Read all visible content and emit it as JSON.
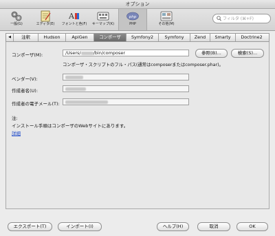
{
  "window": {
    "title": "オプション"
  },
  "toolbar": {
    "items": [
      {
        "label": "一般(G)",
        "icon": "general-settings-icon"
      },
      {
        "label": "エディタ(E)",
        "icon": "editor-icon"
      },
      {
        "label": "フォントと色(F)",
        "icon": "fonts-colors-icon"
      },
      {
        "label": "キーマップ(K)",
        "icon": "keymap-icon"
      },
      {
        "label": "PHP",
        "icon": "php-icon",
        "active": true
      },
      {
        "label": "その他(M)",
        "icon": "misc-icon"
      }
    ],
    "search_placeholder": "フィルタ (⌘+F)"
  },
  "tabs": {
    "items": [
      "注釈",
      "Hudson",
      "ApiGen",
      "コンポーザ",
      "Symfony2",
      "Symfony",
      "Zend",
      "Smarty",
      "Doctrine2"
    ],
    "active": "コンポーザ"
  },
  "form": {
    "composer_label": "コンポーザ(M):",
    "composer_value_prefix": "/Users/",
    "composer_value_suffix": "/bin/composer",
    "browse_button": "参照(B)...",
    "search_button": "検索(S)...",
    "composer_hint": "コンポーザ・スクリプトのフル・パス(通常はcomposerまたはcomposer.phar)。",
    "vendor_label": "ベンダー(V):",
    "author_label": "作成者名(U):",
    "email_label": "作成者の電子メール(T):"
  },
  "note": {
    "title": "注:",
    "text": "インストール手順はコンポーザのWebサイトにあります。",
    "link": "詳細"
  },
  "footer": {
    "export": "エクスポート(T)",
    "import": "インポート(I)",
    "help": "ヘルプ(H)",
    "cancel": "取消",
    "ok": "OK"
  }
}
